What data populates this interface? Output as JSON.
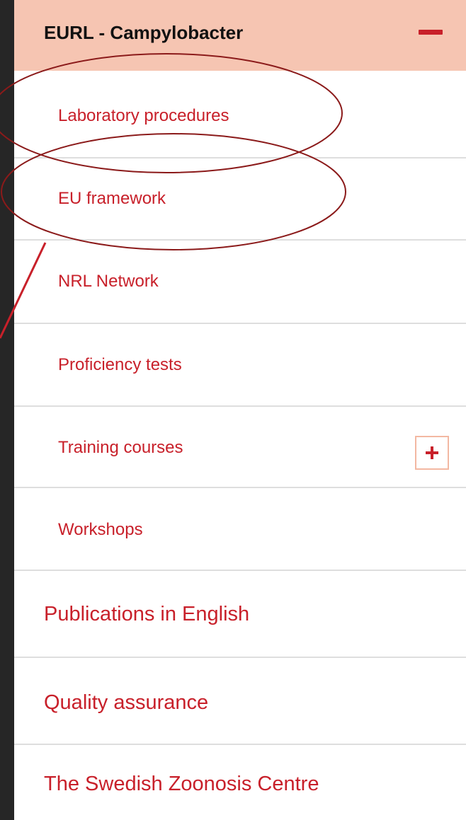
{
  "header": {
    "title": "EURL - Campylobacter",
    "collapse_icon": "minus-icon"
  },
  "submenu": [
    {
      "label": "Laboratory procedures"
    },
    {
      "label": "EU framework"
    },
    {
      "label": "NRL Network"
    },
    {
      "label": "Proficiency tests"
    },
    {
      "label": "Training courses",
      "expand_icon": "plus-icon"
    },
    {
      "label": "Workshops"
    }
  ],
  "menu": [
    {
      "label": "Publications in English"
    },
    {
      "label": "Quality assurance"
    },
    {
      "label": "The Swedish Zoonosis Centre"
    }
  ],
  "colors": {
    "accent": "#c8202a",
    "header_bg": "#f6c5b2",
    "divider": "#dedede",
    "page_bg": "#262626",
    "annotation": "#8b1a1a"
  }
}
